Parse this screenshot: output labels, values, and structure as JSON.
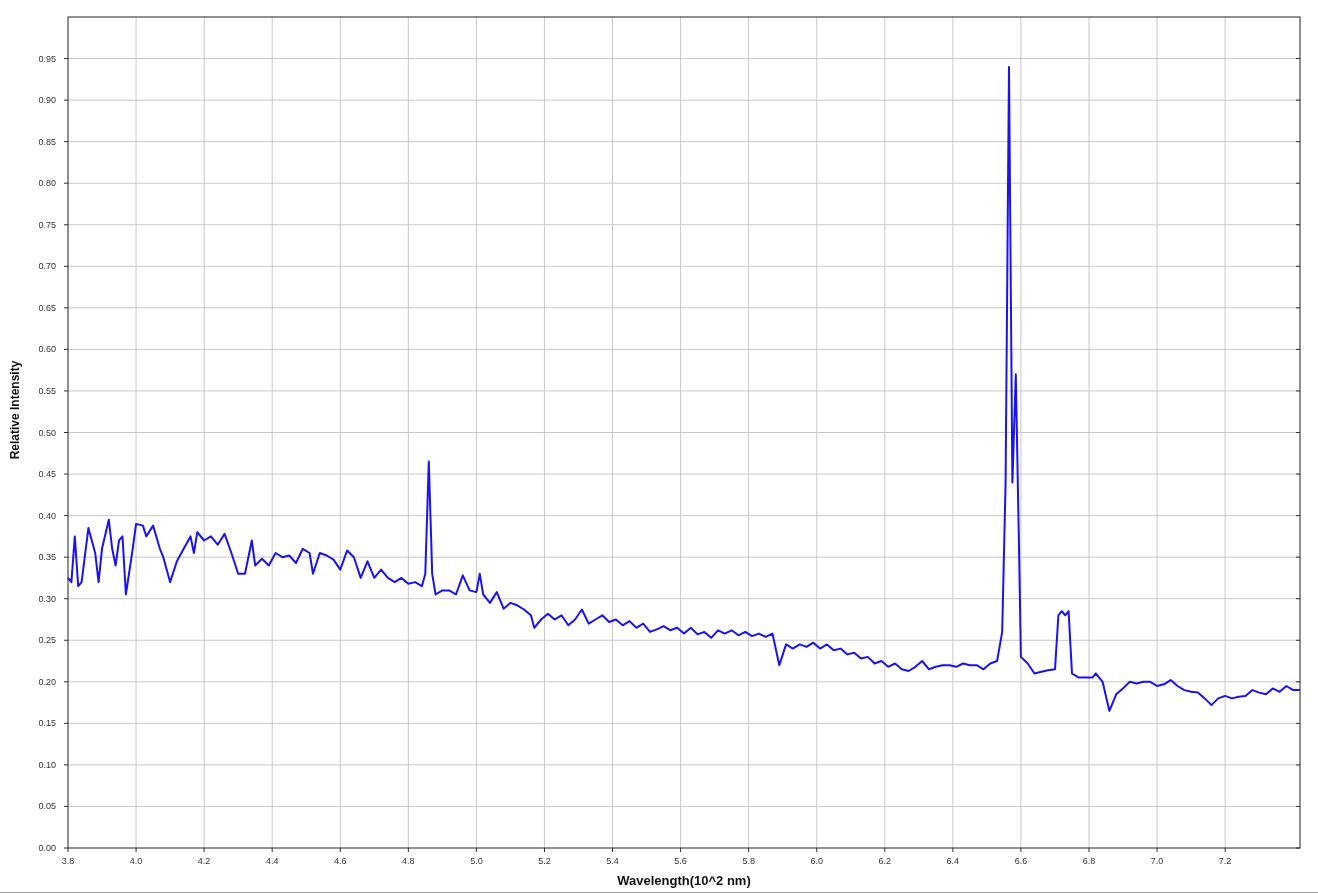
{
  "chart_data": {
    "type": "line",
    "xlabel": "Wavelength(10^2 nm)",
    "ylabel": "Relative Intensity",
    "xlim": [
      3.8,
      7.42
    ],
    "ylim": [
      0,
      1.0
    ],
    "xticks": [
      {
        "value": 3.8,
        "label": "3.8"
      },
      {
        "value": 4.0,
        "label": "4.0"
      },
      {
        "value": 4.2,
        "label": "4.2"
      },
      {
        "value": 4.4,
        "label": "4.4"
      },
      {
        "value": 4.6,
        "label": "4.6"
      },
      {
        "value": 4.8,
        "label": "4.8"
      },
      {
        "value": 5.0,
        "label": "5.0"
      },
      {
        "value": 5.2,
        "label": "5.2"
      },
      {
        "value": 5.4,
        "label": "5.4"
      },
      {
        "value": 5.6,
        "label": "5.6"
      },
      {
        "value": 5.8,
        "label": "5.8"
      },
      {
        "value": 6.0,
        "label": "6.0"
      },
      {
        "value": 6.2,
        "label": "6.2"
      },
      {
        "value": 6.4,
        "label": "6.4"
      },
      {
        "value": 6.6,
        "label": "6.6"
      },
      {
        "value": 6.8,
        "label": "6.8"
      },
      {
        "value": 7.0,
        "label": "7.0"
      },
      {
        "value": 7.2,
        "label": "7.2"
      }
    ],
    "yticks": [
      {
        "value": 0,
        "label": "0.00"
      },
      {
        "value": 0.05,
        "label": "0.05"
      },
      {
        "value": 0.1,
        "label": "0.10"
      },
      {
        "value": 0.15,
        "label": "0.15"
      },
      {
        "value": 0.2,
        "label": "0.20"
      },
      {
        "value": 0.25,
        "label": "0.25"
      },
      {
        "value": 0.3,
        "label": "0.30"
      },
      {
        "value": 0.35,
        "label": "0.35"
      },
      {
        "value": 0.4,
        "label": "0.40"
      },
      {
        "value": 0.45,
        "label": "0.45"
      },
      {
        "value": 0.5,
        "label": "0.50"
      },
      {
        "value": 0.55,
        "label": "0.55"
      },
      {
        "value": 0.6,
        "label": "0.60"
      },
      {
        "value": 0.65,
        "label": "0.65"
      },
      {
        "value": 0.7,
        "label": "0.70"
      },
      {
        "value": 0.75,
        "label": "0.75"
      },
      {
        "value": 0.8,
        "label": "0.80"
      },
      {
        "value": 0.85,
        "label": "0.85"
      },
      {
        "value": 0.9,
        "label": "0.90"
      },
      {
        "value": 0.95,
        "label": "0.95"
      }
    ],
    "x": [
      3.8,
      3.81,
      3.82,
      3.83,
      3.84,
      3.86,
      3.88,
      3.89,
      3.9,
      3.92,
      3.93,
      3.94,
      3.95,
      3.96,
      3.97,
      3.99,
      4.0,
      4.02,
      4.03,
      4.05,
      4.07,
      4.08,
      4.1,
      4.12,
      4.14,
      4.16,
      4.17,
      4.18,
      4.2,
      4.22,
      4.24,
      4.26,
      4.28,
      4.3,
      4.32,
      4.34,
      4.35,
      4.37,
      4.39,
      4.41,
      4.43,
      4.45,
      4.47,
      4.49,
      4.51,
      4.52,
      4.54,
      4.56,
      4.58,
      4.6,
      4.62,
      4.64,
      4.66,
      4.68,
      4.7,
      4.72,
      4.74,
      4.76,
      4.78,
      4.8,
      4.82,
      4.84,
      4.85,
      4.86,
      4.87,
      4.88,
      4.9,
      4.92,
      4.94,
      4.96,
      4.98,
      5.0,
      5.01,
      5.02,
      5.04,
      5.06,
      5.08,
      5.1,
      5.12,
      5.14,
      5.16,
      5.17,
      5.19,
      5.21,
      5.23,
      5.25,
      5.27,
      5.29,
      5.31,
      5.33,
      5.35,
      5.37,
      5.39,
      5.41,
      5.43,
      5.45,
      5.47,
      5.49,
      5.51,
      5.53,
      5.55,
      5.57,
      5.59,
      5.61,
      5.63,
      5.65,
      5.67,
      5.69,
      5.71,
      5.73,
      5.75,
      5.77,
      5.79,
      5.81,
      5.83,
      5.85,
      5.87,
      5.89,
      5.91,
      5.93,
      5.95,
      5.97,
      5.99,
      6.01,
      6.03,
      6.05,
      6.07,
      6.09,
      6.11,
      6.13,
      6.15,
      6.17,
      6.19,
      6.21,
      6.23,
      6.25,
      6.27,
      6.29,
      6.31,
      6.33,
      6.35,
      6.37,
      6.39,
      6.41,
      6.43,
      6.45,
      6.47,
      6.49,
      6.51,
      6.53,
      6.545,
      6.555,
      6.565,
      6.575,
      6.585,
      6.595,
      6.6,
      6.62,
      6.64,
      6.66,
      6.68,
      6.7,
      6.71,
      6.72,
      6.73,
      6.74,
      6.75,
      6.77,
      6.79,
      6.81,
      6.82,
      6.84,
      6.86,
      6.88,
      6.9,
      6.92,
      6.94,
      6.96,
      6.98,
      7.0,
      7.02,
      7.04,
      7.06,
      7.08,
      7.1,
      7.12,
      7.14,
      7.16,
      7.18,
      7.2,
      7.22,
      7.24,
      7.26,
      7.28,
      7.3,
      7.32,
      7.34,
      7.36,
      7.38,
      7.4,
      7.42
    ],
    "grid": true,
    "series": [
      {
        "color": "#1a12f0",
        "values": [
          0.325,
          0.32,
          0.375,
          0.315,
          0.32,
          0.385,
          0.355,
          0.32,
          0.36,
          0.395,
          0.36,
          0.34,
          0.37,
          0.375,
          0.305,
          0.36,
          0.39,
          0.388,
          0.375,
          0.388,
          0.36,
          0.35,
          0.32,
          0.345,
          0.36,
          0.375,
          0.355,
          0.38,
          0.37,
          0.375,
          0.365,
          0.378,
          0.355,
          0.33,
          0.33,
          0.37,
          0.34,
          0.348,
          0.34,
          0.355,
          0.35,
          0.352,
          0.343,
          0.36,
          0.355,
          0.33,
          0.355,
          0.352,
          0.347,
          0.335,
          0.358,
          0.35,
          0.325,
          0.345,
          0.325,
          0.335,
          0.325,
          0.32,
          0.325,
          0.318,
          0.32,
          0.315,
          0.33,
          0.465,
          0.33,
          0.305,
          0.31,
          0.31,
          0.305,
          0.328,
          0.31,
          0.308,
          0.33,
          0.305,
          0.295,
          0.308,
          0.288,
          0.295,
          0.292,
          0.287,
          0.28,
          0.265,
          0.275,
          0.282,
          0.275,
          0.28,
          0.268,
          0.275,
          0.287,
          0.27,
          0.275,
          0.28,
          0.272,
          0.275,
          0.268,
          0.273,
          0.265,
          0.27,
          0.26,
          0.263,
          0.267,
          0.262,
          0.265,
          0.258,
          0.265,
          0.257,
          0.26,
          0.253,
          0.262,
          0.258,
          0.262,
          0.256,
          0.26,
          0.255,
          0.258,
          0.254,
          0.258,
          0.22,
          0.245,
          0.24,
          0.245,
          0.242,
          0.247,
          0.24,
          0.245,
          0.238,
          0.24,
          0.233,
          0.235,
          0.228,
          0.23,
          0.222,
          0.225,
          0.218,
          0.222,
          0.215,
          0.213,
          0.218,
          0.225,
          0.215,
          0.218,
          0.22,
          0.22,
          0.218,
          0.222,
          0.22,
          0.22,
          0.215,
          0.222,
          0.225,
          0.26,
          0.44,
          0.94,
          0.44,
          0.57,
          0.35,
          0.23,
          0.222,
          0.21,
          0.212,
          0.214,
          0.215,
          0.28,
          0.285,
          0.28,
          0.285,
          0.21,
          0.205,
          0.205,
          0.205,
          0.21,
          0.2,
          0.165,
          0.185,
          0.192,
          0.2,
          0.198,
          0.2,
          0.2,
          0.195,
          0.197,
          0.202,
          0.195,
          0.19,
          0.188,
          0.187,
          0.18,
          0.172,
          0.18,
          0.183,
          0.18,
          0.182,
          0.183,
          0.19,
          0.187,
          0.185,
          0.192,
          0.188,
          0.195,
          0.19,
          0.19
        ]
      }
    ]
  }
}
